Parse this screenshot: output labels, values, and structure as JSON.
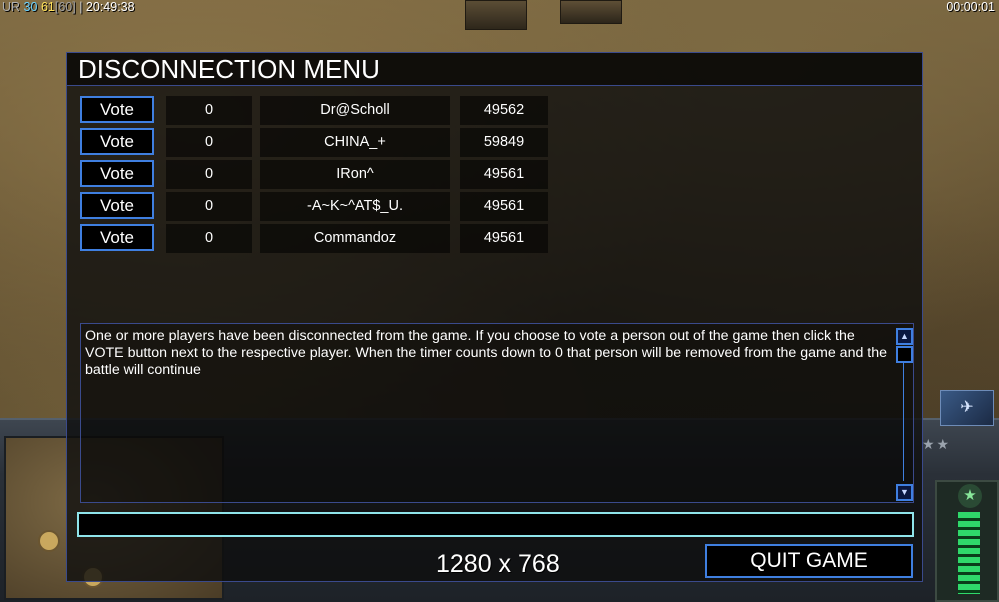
{
  "hud": {
    "label_ur": "UR",
    "val_30": "30",
    "val_61": "61",
    "val_60": "[60]",
    "separator": "|",
    "clock": "20:49:38",
    "game_timer": "00:00:01"
  },
  "dialog": {
    "title": "DISCONNECTION MENU",
    "players": [
      {
        "vote_label": "Vote",
        "votes": "0",
        "name": "Dr@Scholl",
        "id": "49562"
      },
      {
        "vote_label": "Vote",
        "votes": "0",
        "name": "CHINA_+",
        "id": "59849"
      },
      {
        "vote_label": "Vote",
        "votes": "0",
        "name": "IRon^",
        "id": "49561"
      },
      {
        "vote_label": "Vote",
        "votes": "0",
        "name": "-A~K~^AT$_U.",
        "id": "49561"
      },
      {
        "vote_label": "Vote",
        "votes": "0",
        "name": "Commandoz",
        "id": "49561"
      }
    ],
    "message": "One or more players have been disconnected from the game. If you choose to vote a person out of the game then click the VOTE button next to the respective player. When the timer counts down to 0 that person will be removed from the game and the battle will continue",
    "chat_value": "",
    "quit_label": "QUIT GAME"
  },
  "overlay": {
    "resolution": "1280 x 768"
  },
  "colors": {
    "accent_blue": "#3f7fe0",
    "input_cyan": "#8fe4ea",
    "panel_bg": "#0e0e0e"
  }
}
